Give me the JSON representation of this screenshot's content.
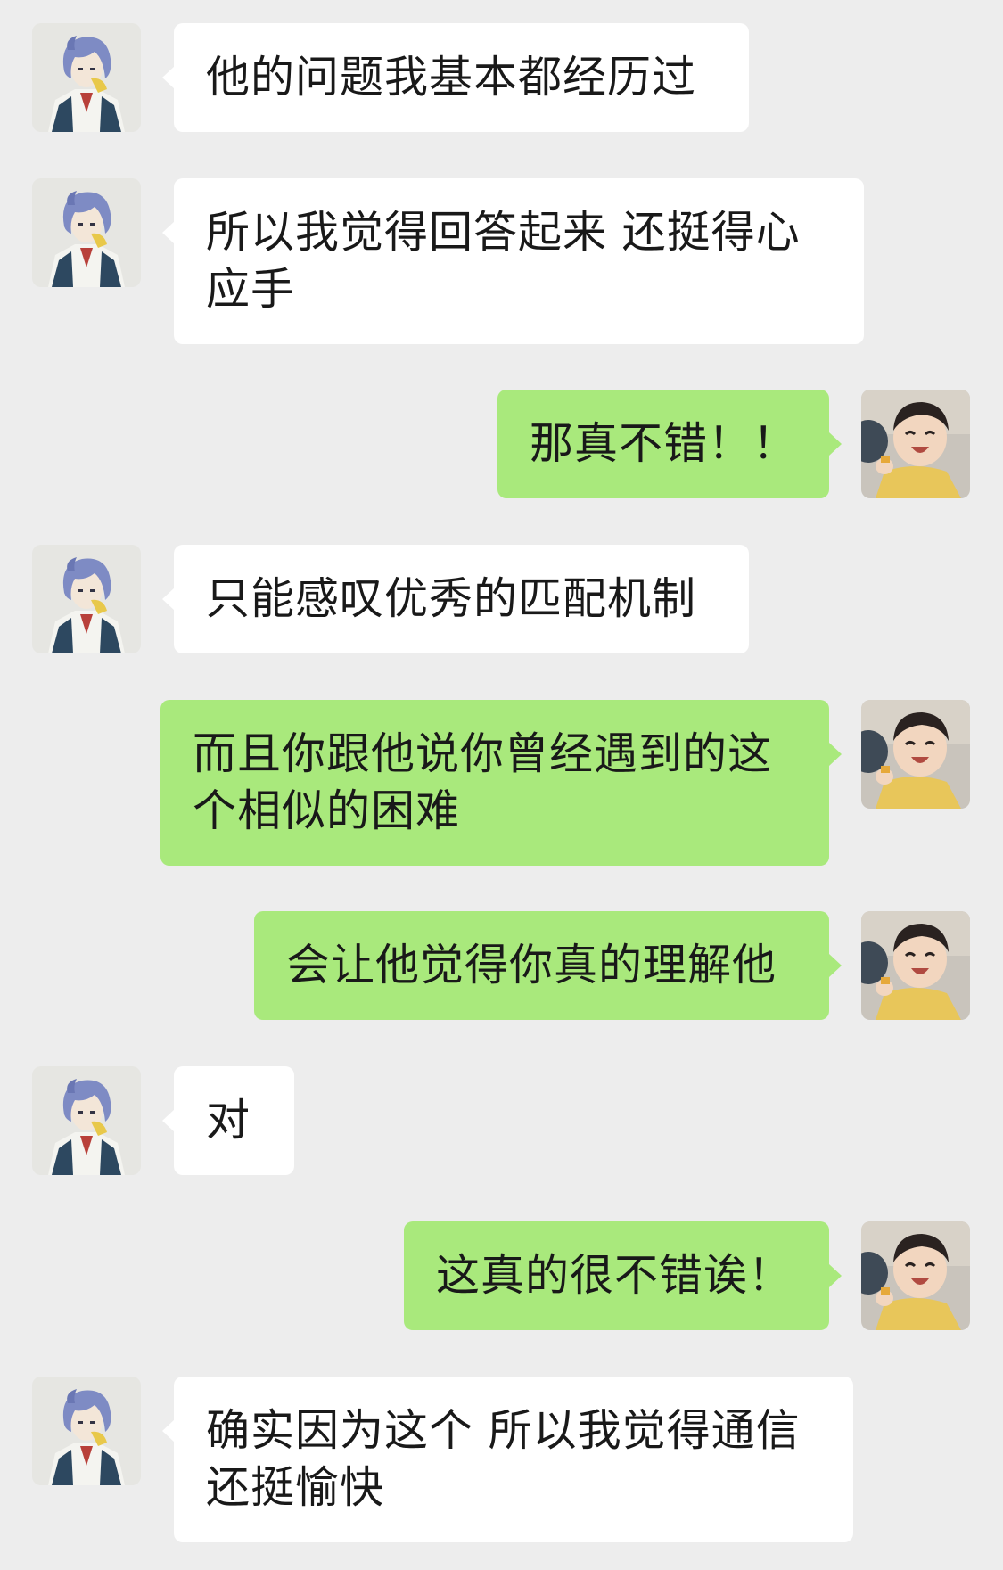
{
  "chat": {
    "messages": [
      {
        "side": "left",
        "text": "他的问题我基本都经历过"
      },
      {
        "side": "left",
        "text": "所以我觉得回答起来  还挺得心应手"
      },
      {
        "side": "right",
        "text": "那真不错！！"
      },
      {
        "side": "left",
        "text": "只能感叹优秀的匹配机制"
      },
      {
        "side": "right",
        "text": "而且你跟他说你曾经遇到的这个相似的困难"
      },
      {
        "side": "right",
        "text": "会让他觉得你真的理解他"
      },
      {
        "side": "left",
        "text": "对"
      },
      {
        "side": "right",
        "text": "这真的很不错诶！"
      },
      {
        "side": "left",
        "text": "确实因为这个 所以我觉得通信还挺愉快"
      }
    ]
  },
  "colors": {
    "background": "#ededed",
    "bubble_incoming": "#ffffff",
    "bubble_outgoing": "#a9e97c",
    "text": "#191919"
  },
  "icons": {
    "incoming_avatar": "anime-character-avatar",
    "outgoing_avatar": "smiling-child-avatar"
  }
}
